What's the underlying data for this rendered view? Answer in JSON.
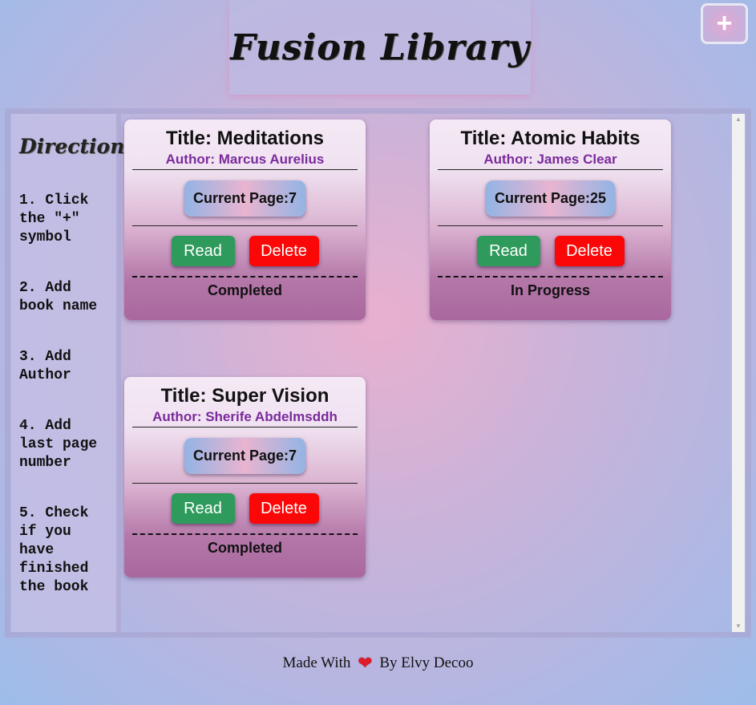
{
  "app": {
    "logo_text": "Fusion Library",
    "add_symbol": "+"
  },
  "sidebar": {
    "title": "Directions",
    "steps": [
      "1. Click the \"+\" symbol",
      "2. Add book name",
      "3. Add Author",
      "4. Add last page number",
      "5. Check if you have finished the book"
    ]
  },
  "books": [
    {
      "title": "Title: Meditations",
      "author": "Author: Marcus Aurelius",
      "page_label": "Current Page:",
      "page": "7",
      "read_label": "Read",
      "delete_label": "Delete",
      "status": "Completed"
    },
    {
      "title": "Title: Atomic Habits",
      "author": "Author: James Clear",
      "page_label": "Current Page:",
      "page": "25",
      "read_label": "Read",
      "delete_label": "Delete",
      "status": "In Progress"
    },
    {
      "title": "Title: Super Vision",
      "author": "Author: Sherife Abdelmsddh",
      "page_label": "Current Page:",
      "page": "7",
      "read_label": "Read",
      "delete_label": "Delete",
      "status": "Completed"
    }
  ],
  "footer": {
    "before": "Made With",
    "heart": "❤",
    "after": "By Elvy Decoo"
  },
  "colors": {
    "read_button": "#2e9a5b",
    "delete_button": "#fb0707",
    "author_text": "#7a2a9c"
  },
  "icons": {
    "add": "plus-icon",
    "heart": "heart-icon",
    "scroll_up": "scroll-up-arrow-icon",
    "scroll_down": "scroll-down-arrow-icon"
  }
}
